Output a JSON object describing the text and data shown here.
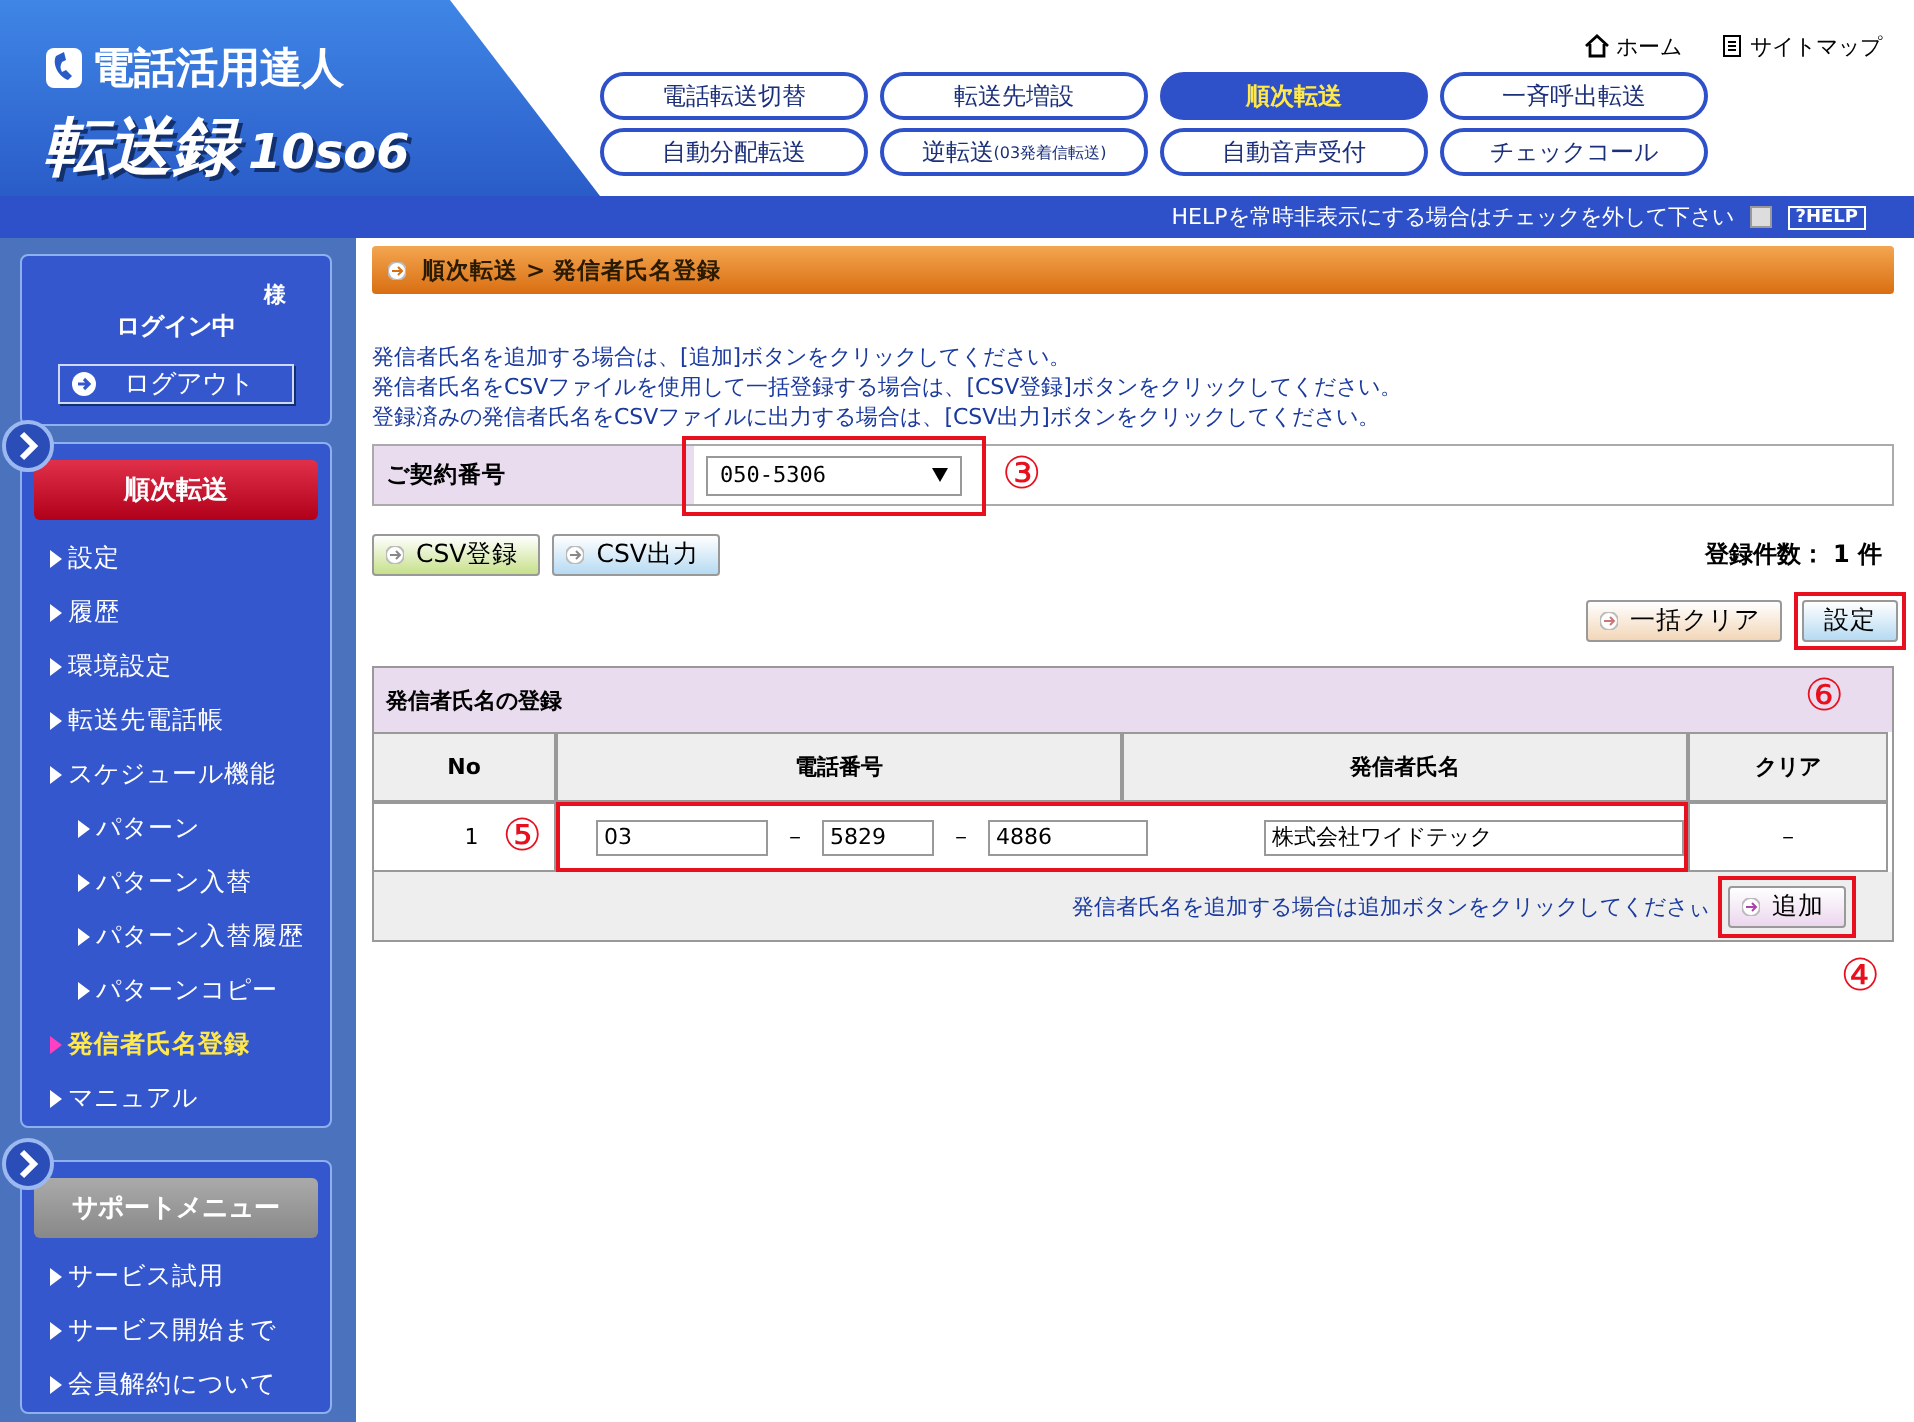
{
  "logo": {
    "line_1": "電話活用達人",
    "line_2": "転送録",
    "suffix": "10so6"
  },
  "top_links": [
    {
      "label": "ホーム",
      "kind": "home"
    },
    {
      "label": "サイトマップ",
      "kind": "sitemap"
    }
  ],
  "nav_tabs": [
    {
      "label": "電話転送切替",
      "selected": false
    },
    {
      "label": "転送先増設",
      "selected": false
    },
    {
      "label": "順次転送",
      "selected": true
    },
    {
      "label": "一斉呼出転送",
      "selected": false
    },
    {
      "label": "自動分配転送",
      "selected": false
    },
    {
      "label": "逆転送",
      "note": "(03発着信転送)",
      "selected": false
    },
    {
      "label": "自動音声受付",
      "selected": false
    },
    {
      "label": "チェックコール",
      "selected": false
    }
  ],
  "help_bar": {
    "text": "HELPを常時非表示にする場合はチェックを外して下さい",
    "checked": false,
    "button": "?HELP"
  },
  "sidebar": {
    "login": {
      "honorific": "様",
      "status": "ログイン中",
      "logout": "ログアウト"
    },
    "menu": {
      "title": "順次転送",
      "items": [
        {
          "label": "設定",
          "selected": false
        },
        {
          "label": "履歴",
          "selected": false
        },
        {
          "label": "環境設定",
          "selected": false
        },
        {
          "label": "転送先電話帳",
          "selected": false
        },
        {
          "label": "スケジュール機能",
          "selected": false,
          "children": [
            {
              "label": "パターン",
              "selected": false
            },
            {
              "label": "パターン入替",
              "selected": false
            },
            {
              "label": "パターン入替履歴",
              "selected": false
            },
            {
              "label": "パターンコピー",
              "selected": false
            }
          ]
        },
        {
          "label": "発信者氏名登録",
          "selected": true
        },
        {
          "label": "マニュアル",
          "selected": false
        }
      ]
    },
    "support": {
      "title": "サポートメニュー",
      "items": [
        {
          "label": "サービス試用",
          "selected": false
        },
        {
          "label": "サービス開始まで",
          "selected": false
        },
        {
          "label": "会員解約について",
          "selected": false
        }
      ]
    }
  },
  "main": {
    "breadcrumb": "順次転送 > 発信者氏名登録",
    "instructions": [
      "発信者氏名を追加する場合は、[追加]ボタンをクリックしてください。",
      "発信者氏名をCSVファイルを使用して一括登録する場合は、[CSV登録]ボタンをクリックしてください。",
      "登録済みの発信者氏名をCSVファイルに出力する場合は、[CSV出力]ボタンをクリックしてください。"
    ],
    "contract": {
      "label": "ご契約番号",
      "value": "050-5306",
      "annotation": "③"
    },
    "csv_buttons": [
      {
        "label": "CSV登録",
        "kind": "import"
      },
      {
        "label": "CSV出力",
        "kind": "export"
      }
    ],
    "count": "登録件数： 1 件",
    "clear_all": "一括クリア",
    "save": {
      "label": "設定",
      "annotation": "⑥"
    },
    "table": {
      "title": "発信者氏名の登録",
      "columns": [
        "No",
        "電話番号",
        "発信者氏名",
        "クリア"
      ],
      "rows": [
        {
          "no": "1",
          "annotation": "⑤",
          "phone": [
            "03",
            "5829",
            "4886"
          ],
          "dash": "－",
          "name": "株式会社ワイドテック",
          "clear": "－"
        }
      ],
      "footer_note": "発信者氏名を追加する場合は追加ボタンをクリックしてくださぃ",
      "add": {
        "label": "追加",
        "annotation": "④"
      }
    }
  }
}
